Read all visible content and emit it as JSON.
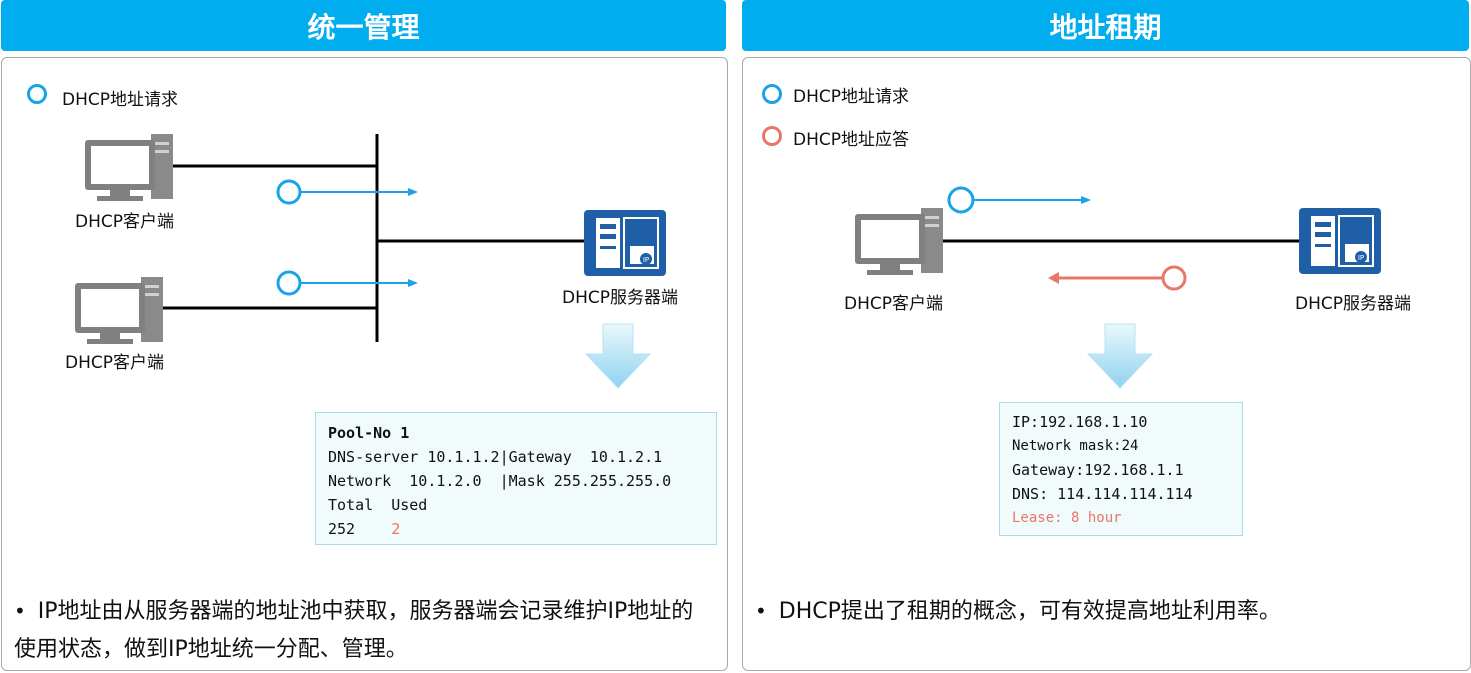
{
  "left": {
    "title": "统一管理",
    "legend": [
      {
        "label": "DHCP地址请求",
        "color": "#1aa3e8"
      }
    ],
    "client_label_1": "DHCP客户端",
    "client_label_2": "DHCP客户端",
    "server_label": "DHCP服务器端",
    "pool": {
      "line1": "Pool-No 1",
      "line2": "DNS-server 10.1.1.2|Gateway  10.1.2.1",
      "line3": "Network  10.1.2.0  |Mask 255.255.255.0",
      "line4": "Total  Used",
      "total": "252",
      "used": "2"
    },
    "bullet": "IP地址由从服务器端的地址池中获取，服务器端会记录维护IP地址的使用状态，做到IP地址统一分配、管理。"
  },
  "right": {
    "title": "地址租期",
    "legend": [
      {
        "label": "DHCP地址请求",
        "color": "#1aa3e8"
      },
      {
        "label": "DHCP地址应答",
        "color": "#e8776a"
      }
    ],
    "client_label": "DHCP客户端",
    "server_label": "DHCP服务器端",
    "lease": {
      "ip": "IP:192.168.1.10",
      "mask": "Network mask:24",
      "gateway": "Gateway:192.168.1.1",
      "dns": "DNS: 114.114.114.114",
      "lease": "Lease: 8 hour"
    },
    "bullet": "DHCP提出了租期的概念，可有效提高地址利用率。"
  },
  "colors": {
    "header": "#00adef",
    "request": "#1aa3e8",
    "reply": "#e8776a",
    "server": "#1e5fa8",
    "pc": "#808080"
  }
}
